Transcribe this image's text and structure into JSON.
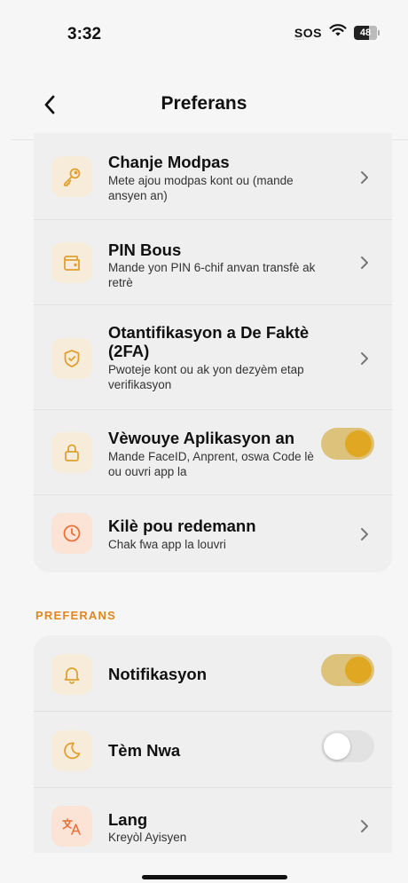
{
  "status_bar": {
    "time": "3:32",
    "sos": "SOS",
    "battery": "48"
  },
  "nav": {
    "title": "Preferans",
    "back_icon": "chevron-left-icon"
  },
  "security": {
    "items": [
      {
        "title": "Chanje Modpas",
        "subtitle": "Mete ajou modpas kont ou (mande ansyen an)",
        "icon": "key-icon",
        "control": "chevron"
      },
      {
        "title": "PIN Bous",
        "subtitle": "Mande yon PIN 6-chif anvan transfè ak retrè",
        "icon": "wallet-icon",
        "control": "chevron"
      },
      {
        "title": "Otantifikasyon a De Faktè (2FA)",
        "subtitle": "Pwoteje kont ou ak yon dezyèm etap verifikasyon",
        "icon": "shield-check-icon",
        "control": "chevron"
      },
      {
        "title": "Vèwouye Aplikasyon an",
        "subtitle": "Mande FaceID, Anprent, oswa Code lè ou ouvri app la",
        "icon": "lock-icon",
        "control": "toggle",
        "toggle_on": true
      },
      {
        "title": "Kilè pou redemann",
        "subtitle": "Chak fwa app la louvri",
        "icon": "clock-icon",
        "control": "chevron"
      }
    ]
  },
  "preferences": {
    "header": "PREFERANS",
    "items": [
      {
        "title": "Notifikasyon",
        "icon": "bell-icon",
        "control": "toggle",
        "toggle_on": true
      },
      {
        "title": "Tèm Nwa",
        "icon": "moon-icon",
        "control": "toggle",
        "toggle_on": false
      },
      {
        "title": "Lang",
        "subtitle": "Kreyòl Ayisyen",
        "icon": "translate-icon",
        "control": "chevron"
      }
    ]
  },
  "colors": {
    "accent": "#e0a822",
    "accent_track": "#dcc27a",
    "section_header": "#e0861e",
    "icon_bg": "#f6ecd9",
    "icon_bg_orange": "#fbe3d6",
    "card_bg": "#efefef",
    "page_bg": "#f6f6f6"
  }
}
